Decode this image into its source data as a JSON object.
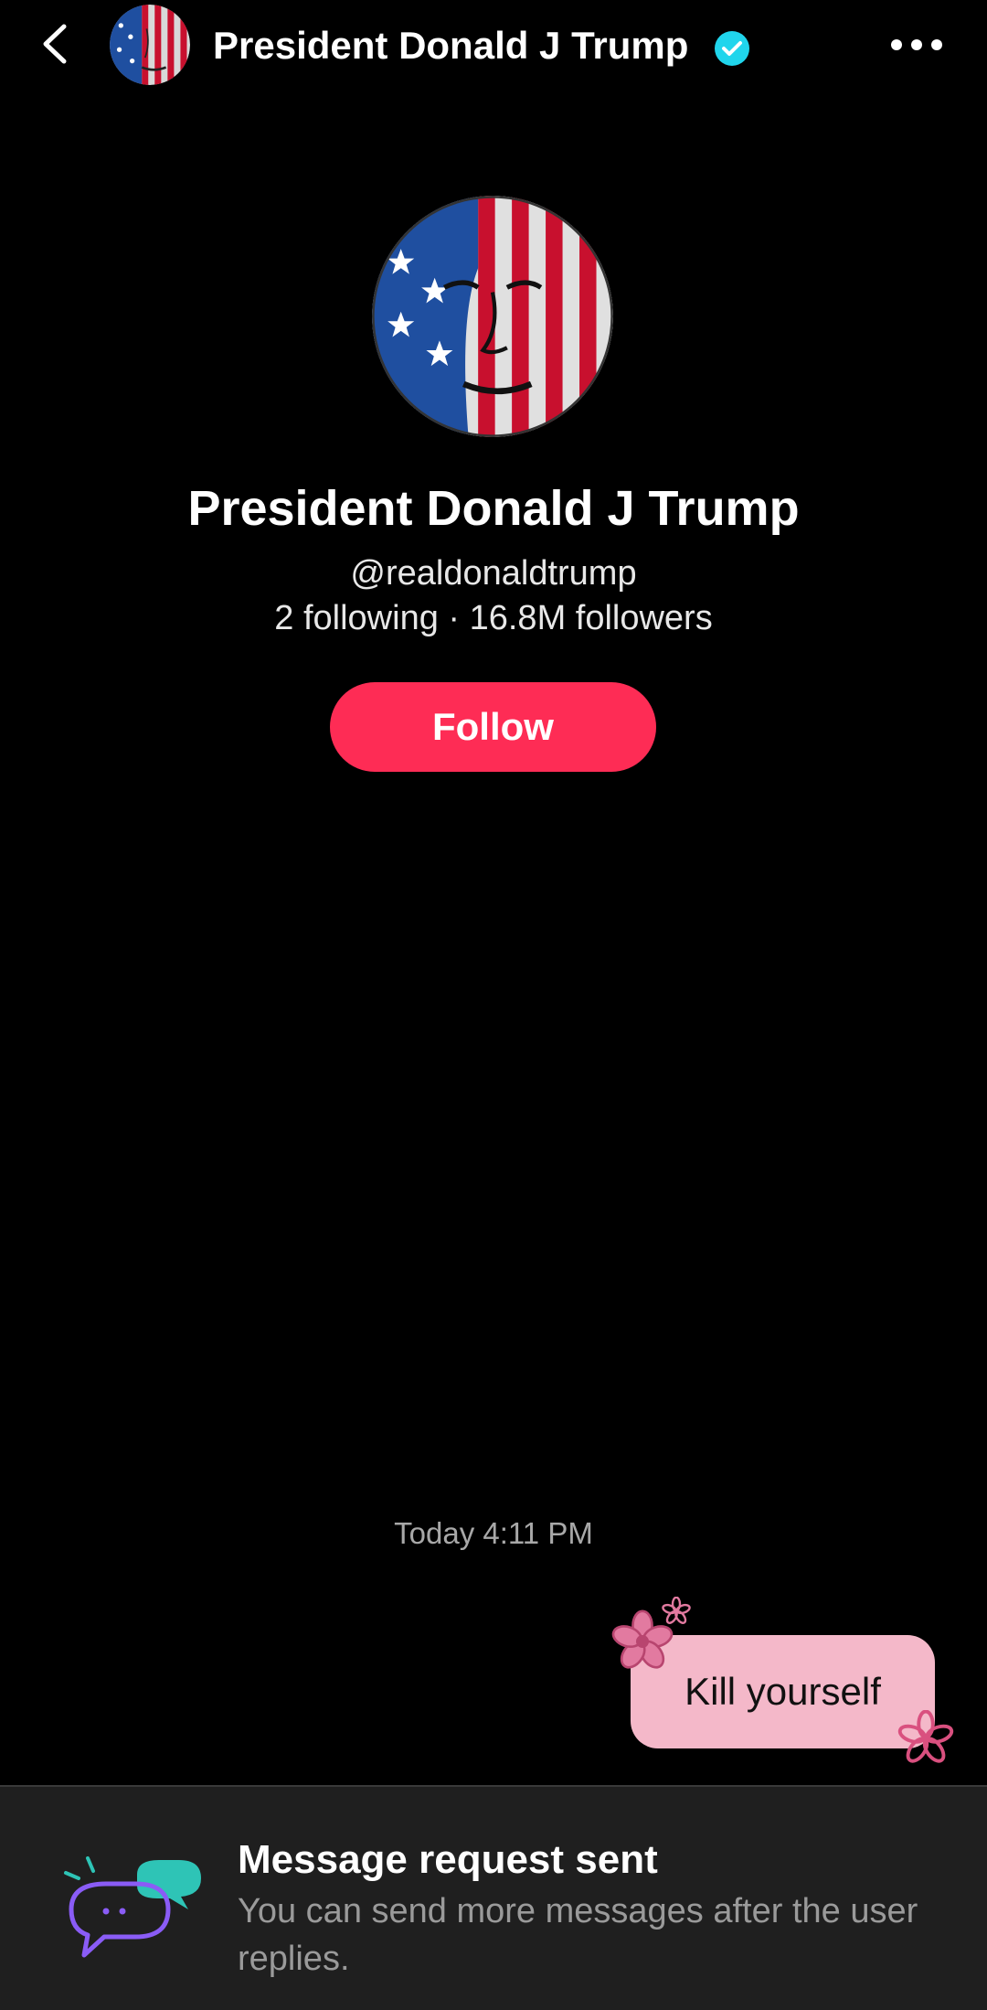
{
  "header": {
    "name": "President Donald J Trump",
    "back_icon": "chevron-left-icon",
    "verified_icon": "verified-check-icon",
    "more_icon": "more-horizontal-icon"
  },
  "profile": {
    "name": "President Donald J Trump",
    "handle": "@realdonaldtrump",
    "stats": "2 following · 16.8M followers",
    "follow_label": "Follow"
  },
  "chat": {
    "timestamp": "Today 4:11 PM",
    "messages": [
      {
        "text": "Kill yourself",
        "sender": "me"
      }
    ]
  },
  "banner": {
    "title": "Message request sent",
    "text": "You can send more messages after the user replies."
  },
  "colors": {
    "follow_button": "#fe2c55",
    "bubble": "#f4b8c9",
    "verified": "#20d5ec",
    "banner_bg": "#1f1f1f"
  }
}
